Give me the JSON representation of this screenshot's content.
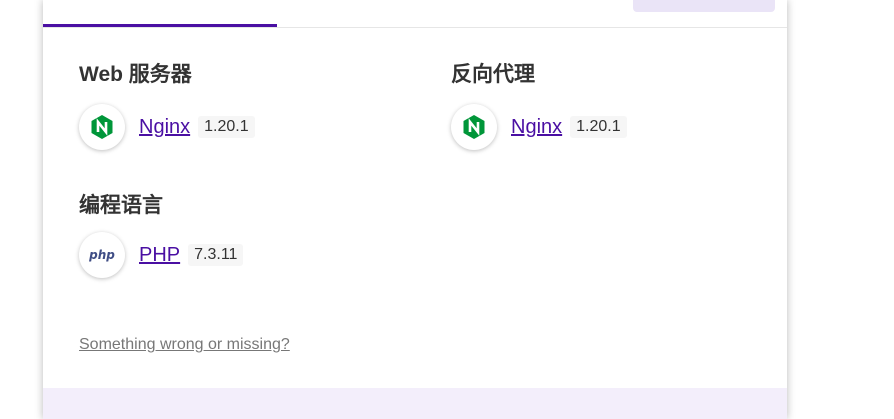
{
  "sections": {
    "web_server": {
      "title": "Web 服务器",
      "items": [
        {
          "name": "Nginx",
          "version": "1.20.1",
          "icon": "nginx-icon"
        }
      ]
    },
    "reverse_proxy": {
      "title": "反向代理",
      "items": [
        {
          "name": "Nginx",
          "version": "1.20.1",
          "icon": "nginx-icon"
        }
      ]
    },
    "programming_language": {
      "title": "编程语言",
      "items": [
        {
          "name": "PHP",
          "version": "7.3.11",
          "icon": "php-icon",
          "icon_text": "php"
        }
      ]
    }
  },
  "footer": {
    "link_label": "Something wrong or missing?"
  },
  "colors": {
    "accent": "#4a0fa3",
    "nginx_green": "#009639",
    "php_blue": "#3f4d85",
    "footer_band": "#f3eefb"
  }
}
